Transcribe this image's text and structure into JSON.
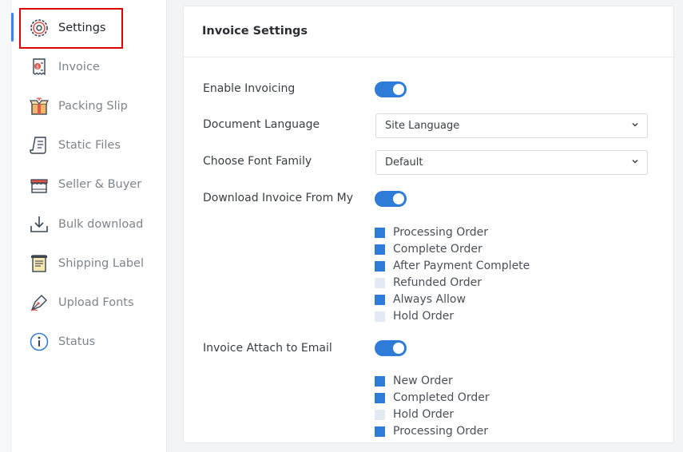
{
  "sidebar": {
    "items": [
      {
        "label": "Settings",
        "icon": "gear-icon"
      },
      {
        "label": "Invoice",
        "icon": "invoice-receipt-icon"
      },
      {
        "label": "Packing Slip",
        "icon": "package-box-icon"
      },
      {
        "label": "Static Files",
        "icon": "scroll-document-icon"
      },
      {
        "label": "Seller & Buyer",
        "icon": "storefront-icon"
      },
      {
        "label": "Bulk download",
        "icon": "download-tray-icon"
      },
      {
        "label": "Shipping Label",
        "icon": "shipping-label-icon"
      },
      {
        "label": "Upload Fonts",
        "icon": "pen-nib-icon"
      },
      {
        "label": "Status",
        "icon": "info-circle-icon"
      }
    ]
  },
  "card": {
    "title": "Invoice Settings",
    "enable_invoicing": {
      "label": "Enable Invoicing",
      "enabled": true
    },
    "document_language": {
      "label": "Document Language",
      "value": "Site Language"
    },
    "font_family": {
      "label": "Choose Font Family",
      "value": "Default"
    },
    "download_from_my": {
      "label": "Download Invoice From My",
      "enabled": true,
      "options": [
        {
          "label": "Processing Order",
          "checked": true
        },
        {
          "label": "Complete Order",
          "checked": true
        },
        {
          "label": "After Payment Complete",
          "checked": true
        },
        {
          "label": "Refunded Order",
          "checked": false
        },
        {
          "label": "Always Allow",
          "checked": true
        },
        {
          "label": "Hold Order",
          "checked": false
        }
      ]
    },
    "attach_to_email": {
      "label": "Invoice Attach to Email",
      "enabled": true,
      "options": [
        {
          "label": "New Order",
          "checked": true
        },
        {
          "label": "Completed Order",
          "checked": true
        },
        {
          "label": "Hold Order",
          "checked": false
        },
        {
          "label": "Processing Order",
          "checked": true
        }
      ]
    }
  },
  "colors": {
    "accent": "#2f7bd8",
    "highlight": "#e00000",
    "checkbox_off": "#e4eaf3"
  }
}
